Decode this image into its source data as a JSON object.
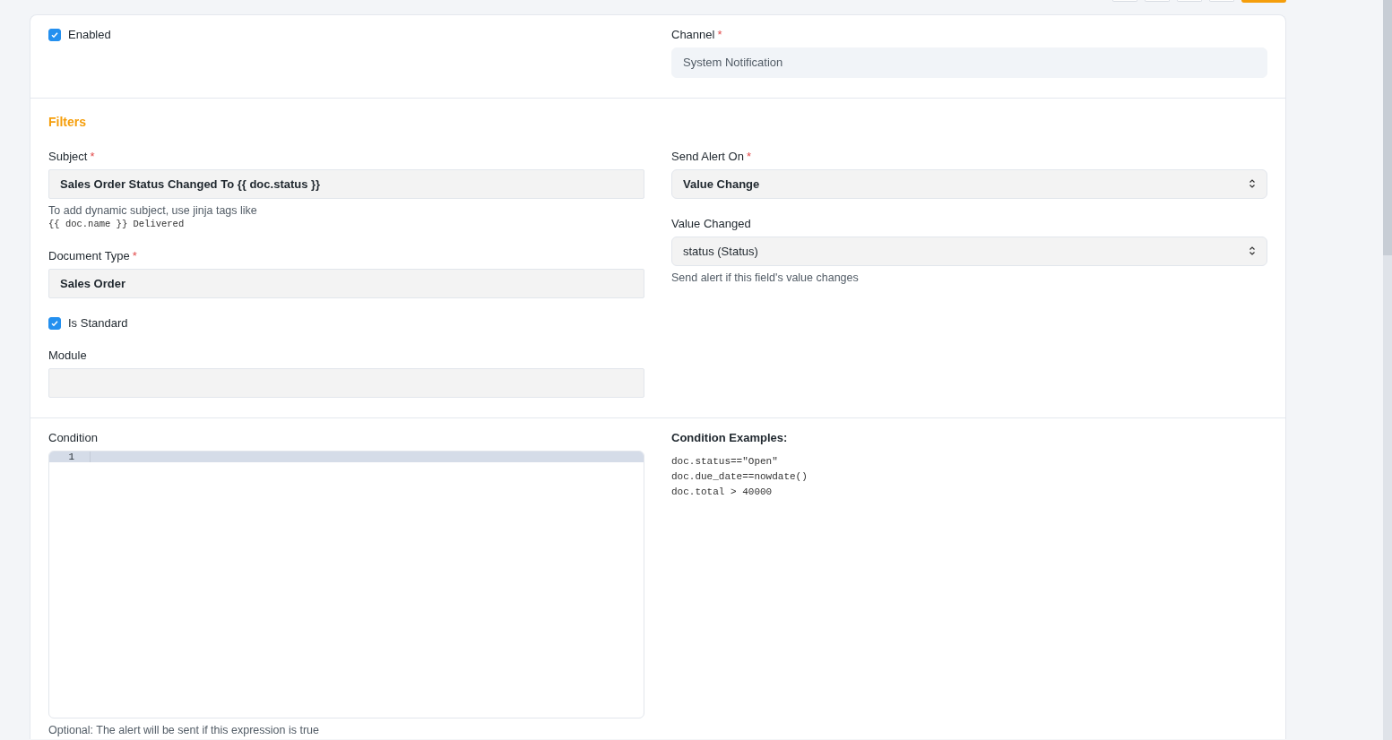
{
  "top_buttons": [
    {
      "kind": "default"
    },
    {
      "kind": "default"
    },
    {
      "kind": "default"
    },
    {
      "kind": "default"
    },
    {
      "kind": "primary"
    }
  ],
  "sections": [
    {
      "columns": [
        [
          {
            "kind": "checkbox",
            "label": "Enabled",
            "checked": true
          }
        ],
        [
          {
            "kind": "readonly",
            "label": "Channel",
            "required_mark": "*",
            "value": "System Notification"
          }
        ]
      ]
    },
    {
      "title": "Filters",
      "columns": [
        [
          {
            "kind": "input",
            "label": "Subject",
            "required_mark": "*",
            "value": "Sales Order Status Changed To {{ doc.status }}",
            "bold": true,
            "help": "To add dynamic subject, use jinja tags like",
            "help_code": "{{ doc.name }} Delivered"
          },
          {
            "kind": "input",
            "label": "Document Type",
            "required_mark": "*",
            "value": "Sales Order",
            "bold": true
          },
          {
            "kind": "checkbox",
            "label": "Is Standard",
            "checked": true
          },
          {
            "kind": "input",
            "label": "Module"
          }
        ],
        [
          {
            "kind": "select",
            "label": "Send Alert On",
            "required_mark": "*",
            "value": "Value Change",
            "bold": true
          },
          {
            "kind": "select",
            "label": "Value Changed",
            "value": "status (Status)",
            "bold": false,
            "help": "Send alert if this field's value changes"
          }
        ]
      ]
    },
    {
      "columns": [
        [
          {
            "kind": "code",
            "label": "Condition",
            "line_numbers": [
              "1"
            ],
            "help": "Optional: The alert will be sent if this expression is true"
          }
        ],
        [
          {
            "kind": "examples",
            "title": "Condition Examples:",
            "lines": [
              "doc.status==\"Open\"",
              "doc.due_date==nowdate()",
              "doc.total > 40000"
            ]
          }
        ]
      ]
    }
  ]
}
